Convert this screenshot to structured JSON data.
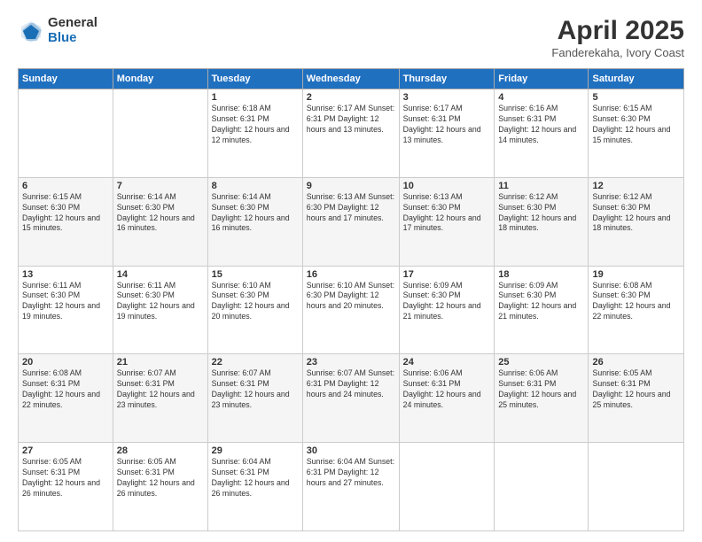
{
  "header": {
    "logo_general": "General",
    "logo_blue": "Blue",
    "title": "April 2025",
    "location": "Fanderekaha, Ivory Coast"
  },
  "days_of_week": [
    "Sunday",
    "Monday",
    "Tuesday",
    "Wednesday",
    "Thursday",
    "Friday",
    "Saturday"
  ],
  "weeks": [
    [
      {
        "day": "",
        "info": ""
      },
      {
        "day": "",
        "info": ""
      },
      {
        "day": "1",
        "info": "Sunrise: 6:18 AM\nSunset: 6:31 PM\nDaylight: 12 hours and 12 minutes."
      },
      {
        "day": "2",
        "info": "Sunrise: 6:17 AM\nSunset: 6:31 PM\nDaylight: 12 hours and 13 minutes."
      },
      {
        "day": "3",
        "info": "Sunrise: 6:17 AM\nSunset: 6:31 PM\nDaylight: 12 hours and 13 minutes."
      },
      {
        "day": "4",
        "info": "Sunrise: 6:16 AM\nSunset: 6:31 PM\nDaylight: 12 hours and 14 minutes."
      },
      {
        "day": "5",
        "info": "Sunrise: 6:15 AM\nSunset: 6:30 PM\nDaylight: 12 hours and 15 minutes."
      }
    ],
    [
      {
        "day": "6",
        "info": "Sunrise: 6:15 AM\nSunset: 6:30 PM\nDaylight: 12 hours and 15 minutes."
      },
      {
        "day": "7",
        "info": "Sunrise: 6:14 AM\nSunset: 6:30 PM\nDaylight: 12 hours and 16 minutes."
      },
      {
        "day": "8",
        "info": "Sunrise: 6:14 AM\nSunset: 6:30 PM\nDaylight: 12 hours and 16 minutes."
      },
      {
        "day": "9",
        "info": "Sunrise: 6:13 AM\nSunset: 6:30 PM\nDaylight: 12 hours and 17 minutes."
      },
      {
        "day": "10",
        "info": "Sunrise: 6:13 AM\nSunset: 6:30 PM\nDaylight: 12 hours and 17 minutes."
      },
      {
        "day": "11",
        "info": "Sunrise: 6:12 AM\nSunset: 6:30 PM\nDaylight: 12 hours and 18 minutes."
      },
      {
        "day": "12",
        "info": "Sunrise: 6:12 AM\nSunset: 6:30 PM\nDaylight: 12 hours and 18 minutes."
      }
    ],
    [
      {
        "day": "13",
        "info": "Sunrise: 6:11 AM\nSunset: 6:30 PM\nDaylight: 12 hours and 19 minutes."
      },
      {
        "day": "14",
        "info": "Sunrise: 6:11 AM\nSunset: 6:30 PM\nDaylight: 12 hours and 19 minutes."
      },
      {
        "day": "15",
        "info": "Sunrise: 6:10 AM\nSunset: 6:30 PM\nDaylight: 12 hours and 20 minutes."
      },
      {
        "day": "16",
        "info": "Sunrise: 6:10 AM\nSunset: 6:30 PM\nDaylight: 12 hours and 20 minutes."
      },
      {
        "day": "17",
        "info": "Sunrise: 6:09 AM\nSunset: 6:30 PM\nDaylight: 12 hours and 21 minutes."
      },
      {
        "day": "18",
        "info": "Sunrise: 6:09 AM\nSunset: 6:30 PM\nDaylight: 12 hours and 21 minutes."
      },
      {
        "day": "19",
        "info": "Sunrise: 6:08 AM\nSunset: 6:30 PM\nDaylight: 12 hours and 22 minutes."
      }
    ],
    [
      {
        "day": "20",
        "info": "Sunrise: 6:08 AM\nSunset: 6:31 PM\nDaylight: 12 hours and 22 minutes."
      },
      {
        "day": "21",
        "info": "Sunrise: 6:07 AM\nSunset: 6:31 PM\nDaylight: 12 hours and 23 minutes."
      },
      {
        "day": "22",
        "info": "Sunrise: 6:07 AM\nSunset: 6:31 PM\nDaylight: 12 hours and 23 minutes."
      },
      {
        "day": "23",
        "info": "Sunrise: 6:07 AM\nSunset: 6:31 PM\nDaylight: 12 hours and 24 minutes."
      },
      {
        "day": "24",
        "info": "Sunrise: 6:06 AM\nSunset: 6:31 PM\nDaylight: 12 hours and 24 minutes."
      },
      {
        "day": "25",
        "info": "Sunrise: 6:06 AM\nSunset: 6:31 PM\nDaylight: 12 hours and 25 minutes."
      },
      {
        "day": "26",
        "info": "Sunrise: 6:05 AM\nSunset: 6:31 PM\nDaylight: 12 hours and 25 minutes."
      }
    ],
    [
      {
        "day": "27",
        "info": "Sunrise: 6:05 AM\nSunset: 6:31 PM\nDaylight: 12 hours and 26 minutes."
      },
      {
        "day": "28",
        "info": "Sunrise: 6:05 AM\nSunset: 6:31 PM\nDaylight: 12 hours and 26 minutes."
      },
      {
        "day": "29",
        "info": "Sunrise: 6:04 AM\nSunset: 6:31 PM\nDaylight: 12 hours and 26 minutes."
      },
      {
        "day": "30",
        "info": "Sunrise: 6:04 AM\nSunset: 6:31 PM\nDaylight: 12 hours and 27 minutes."
      },
      {
        "day": "",
        "info": ""
      },
      {
        "day": "",
        "info": ""
      },
      {
        "day": "",
        "info": ""
      }
    ]
  ]
}
